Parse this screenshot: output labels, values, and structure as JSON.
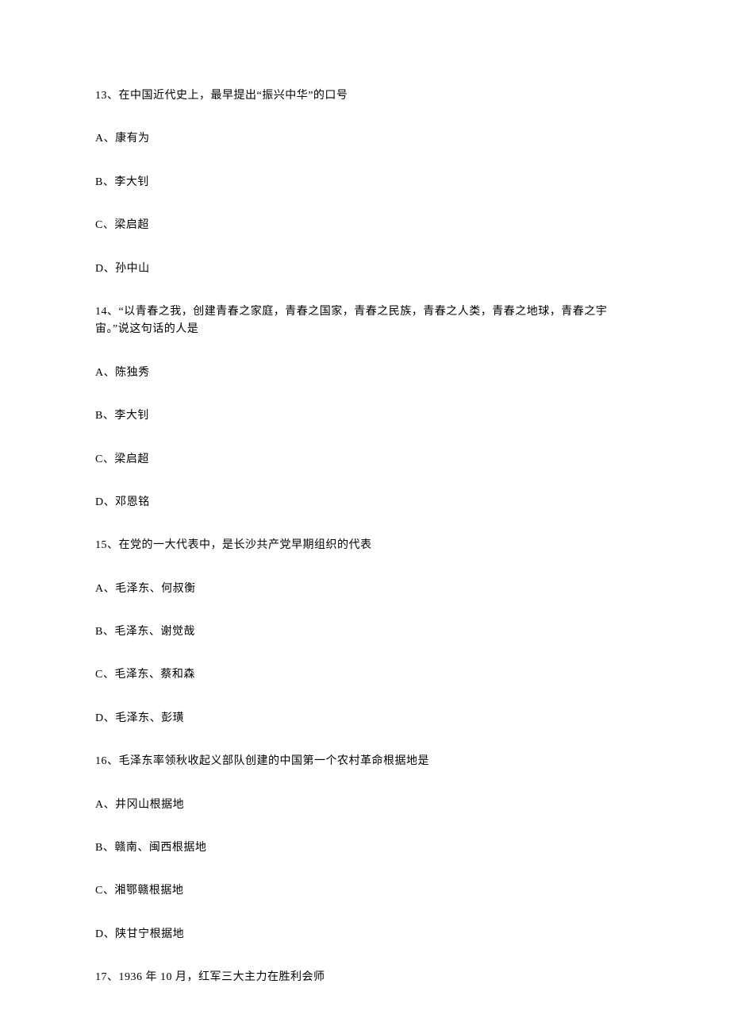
{
  "questions": [
    {
      "number": "13",
      "prompt": "在中国近代史上，最早提出“振兴中华”的口号",
      "options": [
        {
          "letter": "A",
          "text": "康有为"
        },
        {
          "letter": "B",
          "text": "李大钊"
        },
        {
          "letter": "C",
          "text": "梁启超"
        },
        {
          "letter": "D",
          "text": "孙中山"
        }
      ]
    },
    {
      "number": "14",
      "prompt": "“以青春之我，创建青春之家庭，青春之国家，青春之民族，青春之人类，青春之地球，青春之宇宙。”说这句话的人是",
      "options": [
        {
          "letter": "A",
          "text": "陈独秀"
        },
        {
          "letter": "B",
          "text": "李大钊"
        },
        {
          "letter": "C",
          "text": "梁启超"
        },
        {
          "letter": "D",
          "text": "邓恩铭"
        }
      ]
    },
    {
      "number": "15",
      "prompt": "在党的一大代表中，是长沙共产党早期组织的代表",
      "options": [
        {
          "letter": "A",
          "text": "毛泽东、何叔衡"
        },
        {
          "letter": "B",
          "text": "毛泽东、谢觉哉"
        },
        {
          "letter": "C",
          "text": "毛泽东、蔡和森"
        },
        {
          "letter": "D",
          "text": "毛泽东、彭璜"
        }
      ]
    },
    {
      "number": "16",
      "prompt": "毛泽东率领秋收起义部队创建的中国第一个农村革命根据地是",
      "options": [
        {
          "letter": "A",
          "text": "井冈山根据地"
        },
        {
          "letter": "B",
          "text": "赣南、闽西根据地"
        },
        {
          "letter": "C",
          "text": "湘鄂赣根据地"
        },
        {
          "letter": "D",
          "text": "陕甘宁根据地"
        }
      ]
    },
    {
      "number": "17",
      "prompt": "1936 年 10 月，红军三大主力在胜利会师",
      "options": []
    }
  ],
  "separator": "、"
}
